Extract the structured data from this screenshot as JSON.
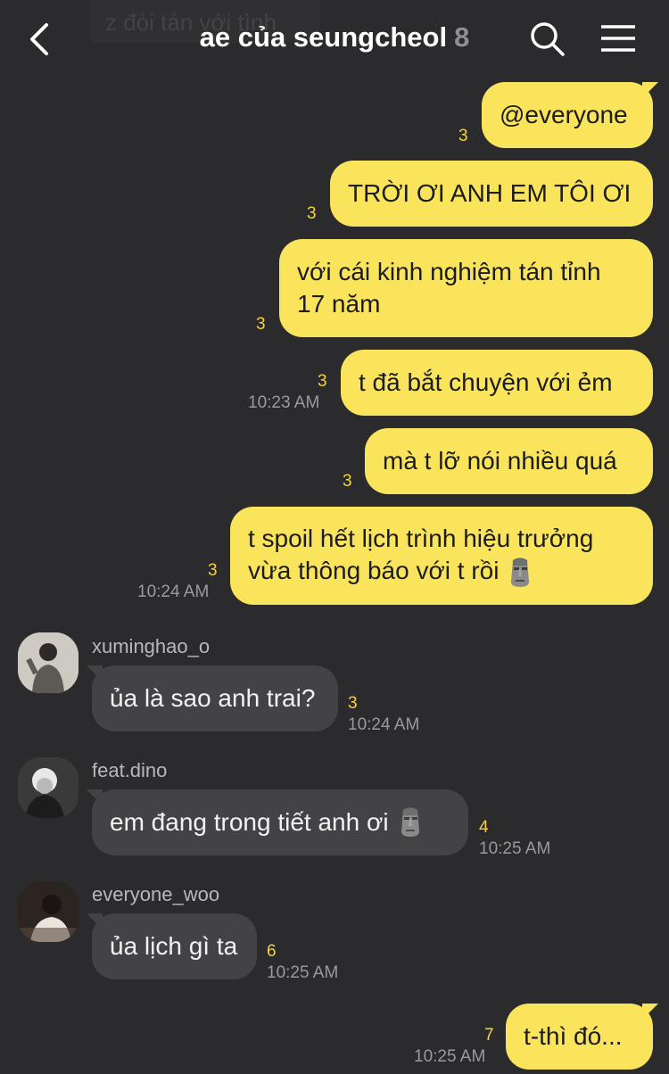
{
  "header": {
    "back_icon": "chevron-left-icon",
    "title": "ae của seungcheol",
    "member_count": "8",
    "search_icon": "search-icon",
    "menu_icon": "menu-icon",
    "ghost_text": "z đòi tán với tình"
  },
  "messages": [
    {
      "text": "@everyone",
      "unread": "3"
    },
    {
      "text": "TRỜI ƠI ANH EM TÔI ƠI",
      "unread": "3"
    },
    {
      "line1": "với cái kinh nghiệm tán tỉnh",
      "line2": "17 năm",
      "unread": "3"
    },
    {
      "text": "t đã bắt chuyện với ẻm",
      "unread": "3",
      "time": "10:23 AM"
    },
    {
      "text": "mà t lỡ nói nhiều quá",
      "unread": "3"
    },
    {
      "line1": "t spoil hết lịch trình hiệu trưởng",
      "line2": "vừa thông báo với t rồi",
      "emoji": "moai-emoji",
      "unread": "3",
      "time": "10:24 AM"
    },
    {
      "sender": "xuminghao_o",
      "text": "ủa là sao anh trai?",
      "unread": "3",
      "time": "10:24 AM"
    },
    {
      "sender": "feat.dino",
      "text": "em đang trong tiết anh ơi",
      "emoji": "moai-emoji",
      "unread": "4",
      "time": "10:25 AM"
    },
    {
      "sender": "everyone_woo",
      "text": "ủa lịch gì ta",
      "unread": "6",
      "time": "10:25 AM"
    },
    {
      "text": "t-thì đó...",
      "unread": "7",
      "time": "10:25 AM"
    }
  ],
  "colors": {
    "background": "#2b2b2d",
    "my_bubble": "#f9e45b",
    "their_bubble": "#434346",
    "unread": "#f5d33c",
    "time": "#9a9a9e"
  }
}
